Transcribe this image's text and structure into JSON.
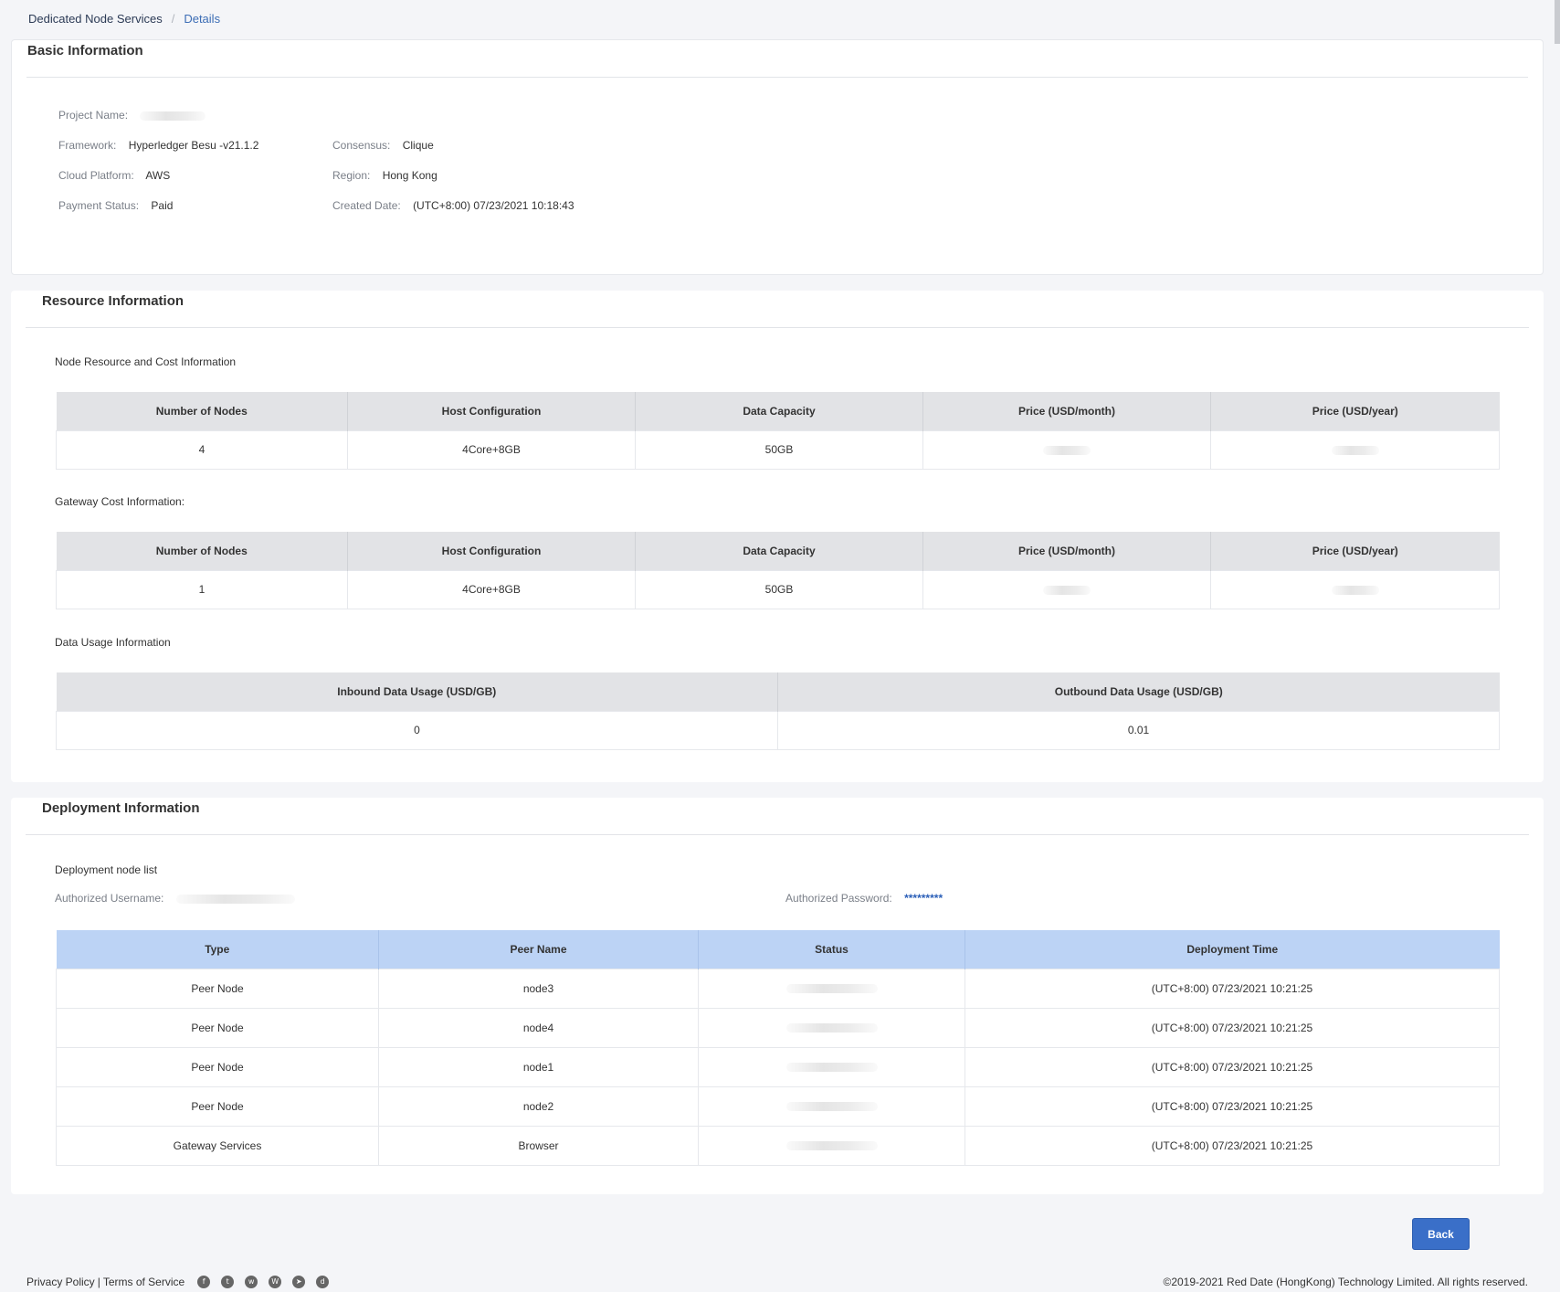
{
  "breadcrumb": {
    "root": "Dedicated Node Services",
    "separator": "/",
    "current": "Details"
  },
  "basic": {
    "title": "Basic Information",
    "project_name_label": "Project Name:",
    "framework_label": "Framework:",
    "framework_value": "Hyperledger Besu -v21.1.2",
    "consensus_label": "Consensus:",
    "consensus_value": "Clique",
    "cloud_label": "Cloud Platform:",
    "cloud_value": "AWS",
    "region_label": "Region:",
    "region_value": "Hong Kong",
    "payment_label": "Payment Status:",
    "payment_value": "Paid",
    "created_label": "Created Date:",
    "created_value": "(UTC+8:00) 07/23/2021 10:18:43"
  },
  "resource": {
    "title": "Resource Information",
    "node_section_label": "Node Resource and Cost Information",
    "gateway_section_label": "Gateway Cost Information:",
    "usage_section_label": "Data Usage Information",
    "cost_headers": [
      "Number of Nodes",
      "Host Configuration",
      "Data Capacity",
      "Price (USD/month)",
      "Price (USD/year)"
    ],
    "node_row": {
      "nodes": "4",
      "host": "4Core+8GB",
      "capacity": "50GB"
    },
    "gateway_row": {
      "nodes": "1",
      "host": "4Core+8GB",
      "capacity": "50GB"
    },
    "usage_headers": [
      "Inbound Data Usage (USD/GB)",
      "Outbound Data Usage (USD/GB)"
    ],
    "usage_row": {
      "inbound": "0",
      "outbound": "0.01"
    }
  },
  "deployment": {
    "title": "Deployment Information",
    "list_label": "Deployment node list",
    "username_label": "Authorized Username:",
    "password_label": "Authorized Password:",
    "password_value": "*********",
    "headers": [
      "Type",
      "Peer Name",
      "Status",
      "Deployment Time"
    ],
    "rows": [
      {
        "type": "Peer Node",
        "peer": "node3",
        "time": "(UTC+8:00) 07/23/2021 10:21:25"
      },
      {
        "type": "Peer Node",
        "peer": "node4",
        "time": "(UTC+8:00) 07/23/2021 10:21:25"
      },
      {
        "type": "Peer Node",
        "peer": "node1",
        "time": "(UTC+8:00) 07/23/2021 10:21:25"
      },
      {
        "type": "Peer Node",
        "peer": "node2",
        "time": "(UTC+8:00) 07/23/2021 10:21:25"
      },
      {
        "type": "Gateway Services",
        "peer": "Browser",
        "time": "(UTC+8:00) 07/23/2021 10:21:25"
      }
    ]
  },
  "actions": {
    "back_label": "Back"
  },
  "footer": {
    "privacy": "Privacy Policy",
    "divider": "|",
    "terms": "Terms of Service",
    "copyright": "©2019-2021 Red Date (HongKong) Technology Limited. All rights reserved.",
    "social_icons": [
      "facebook-icon",
      "twitter-icon",
      "wechat-icon",
      "weibo-icon",
      "telegram-icon",
      "discord-icon"
    ]
  }
}
